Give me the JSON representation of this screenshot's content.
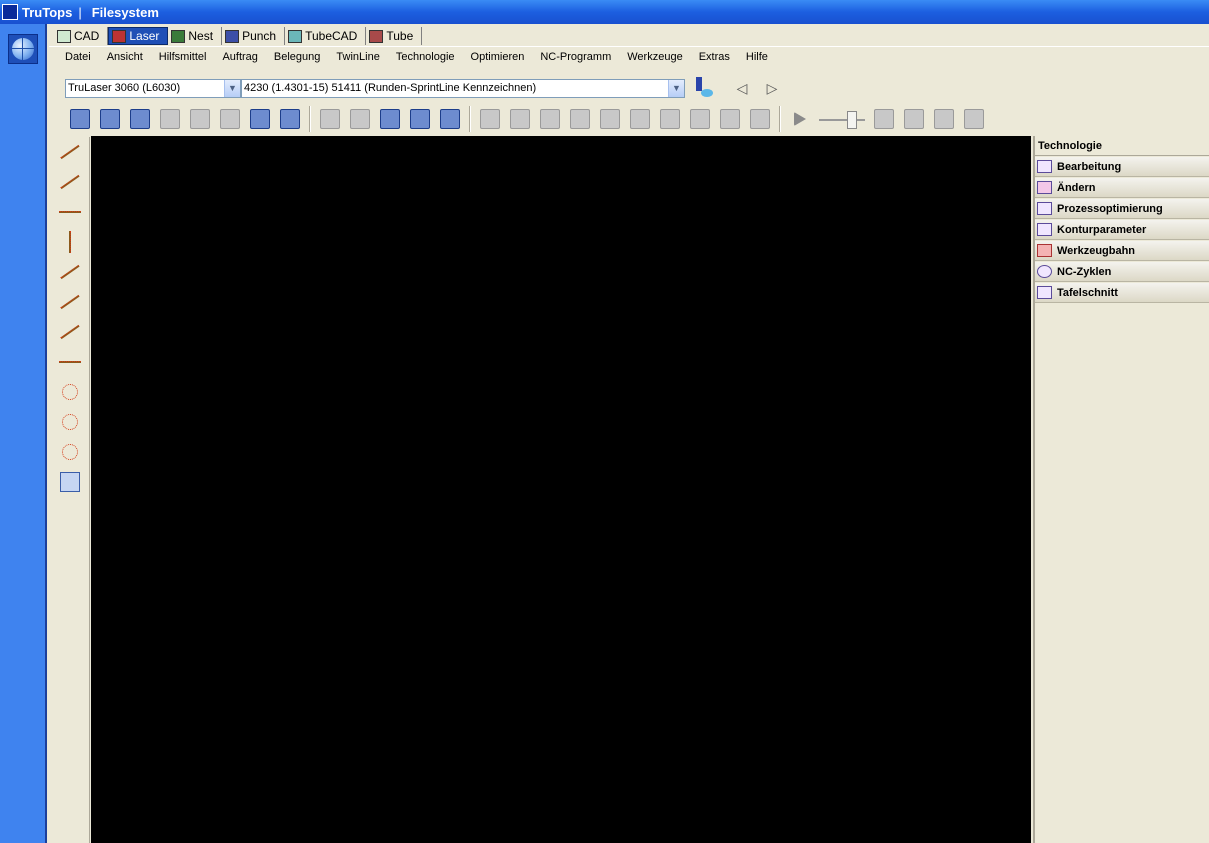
{
  "titlebar": {
    "app": "TruTops",
    "separator": "|",
    "section": "Filesystem"
  },
  "tabs": [
    {
      "label": "CAD",
      "active": false,
      "icon": "cad-icon"
    },
    {
      "label": "Laser",
      "active": true,
      "icon": "laser-icon"
    },
    {
      "label": "Nest",
      "active": false,
      "icon": "nest-icon"
    },
    {
      "label": "Punch",
      "active": false,
      "icon": "punch-icon"
    },
    {
      "label": "TubeCAD",
      "active": false,
      "icon": "tubecad-icon"
    },
    {
      "label": "Tube",
      "active": false,
      "icon": "tube-icon"
    }
  ],
  "menu": [
    "Datei",
    "Ansicht",
    "Hilfsmittel",
    "Auftrag",
    "Belegung",
    "TwinLine",
    "Technologie",
    "Optimieren",
    "NC-Programm",
    "Werkzeuge",
    "Extras",
    "Hilfe"
  ],
  "machine_select": {
    "value": "TruLaser 3060 (L6030)"
  },
  "material_select": {
    "value": "4230  (1.4301-15)  51411  (Runden-SprintLine Kennzeichnen)"
  },
  "right_panel": {
    "title": "Technologie",
    "items": [
      "Bearbeitung",
      "Ändern",
      "Prozessoptimierung",
      "Konturparameter",
      "Werkzeugbahn",
      "NC-Zyklen",
      "Tafelschnitt"
    ]
  },
  "colors": {
    "titlebar": "#1c5fe0",
    "active_tab": "#1f4fb6",
    "canvas": "#000000",
    "chrome": "#ece9d8"
  }
}
